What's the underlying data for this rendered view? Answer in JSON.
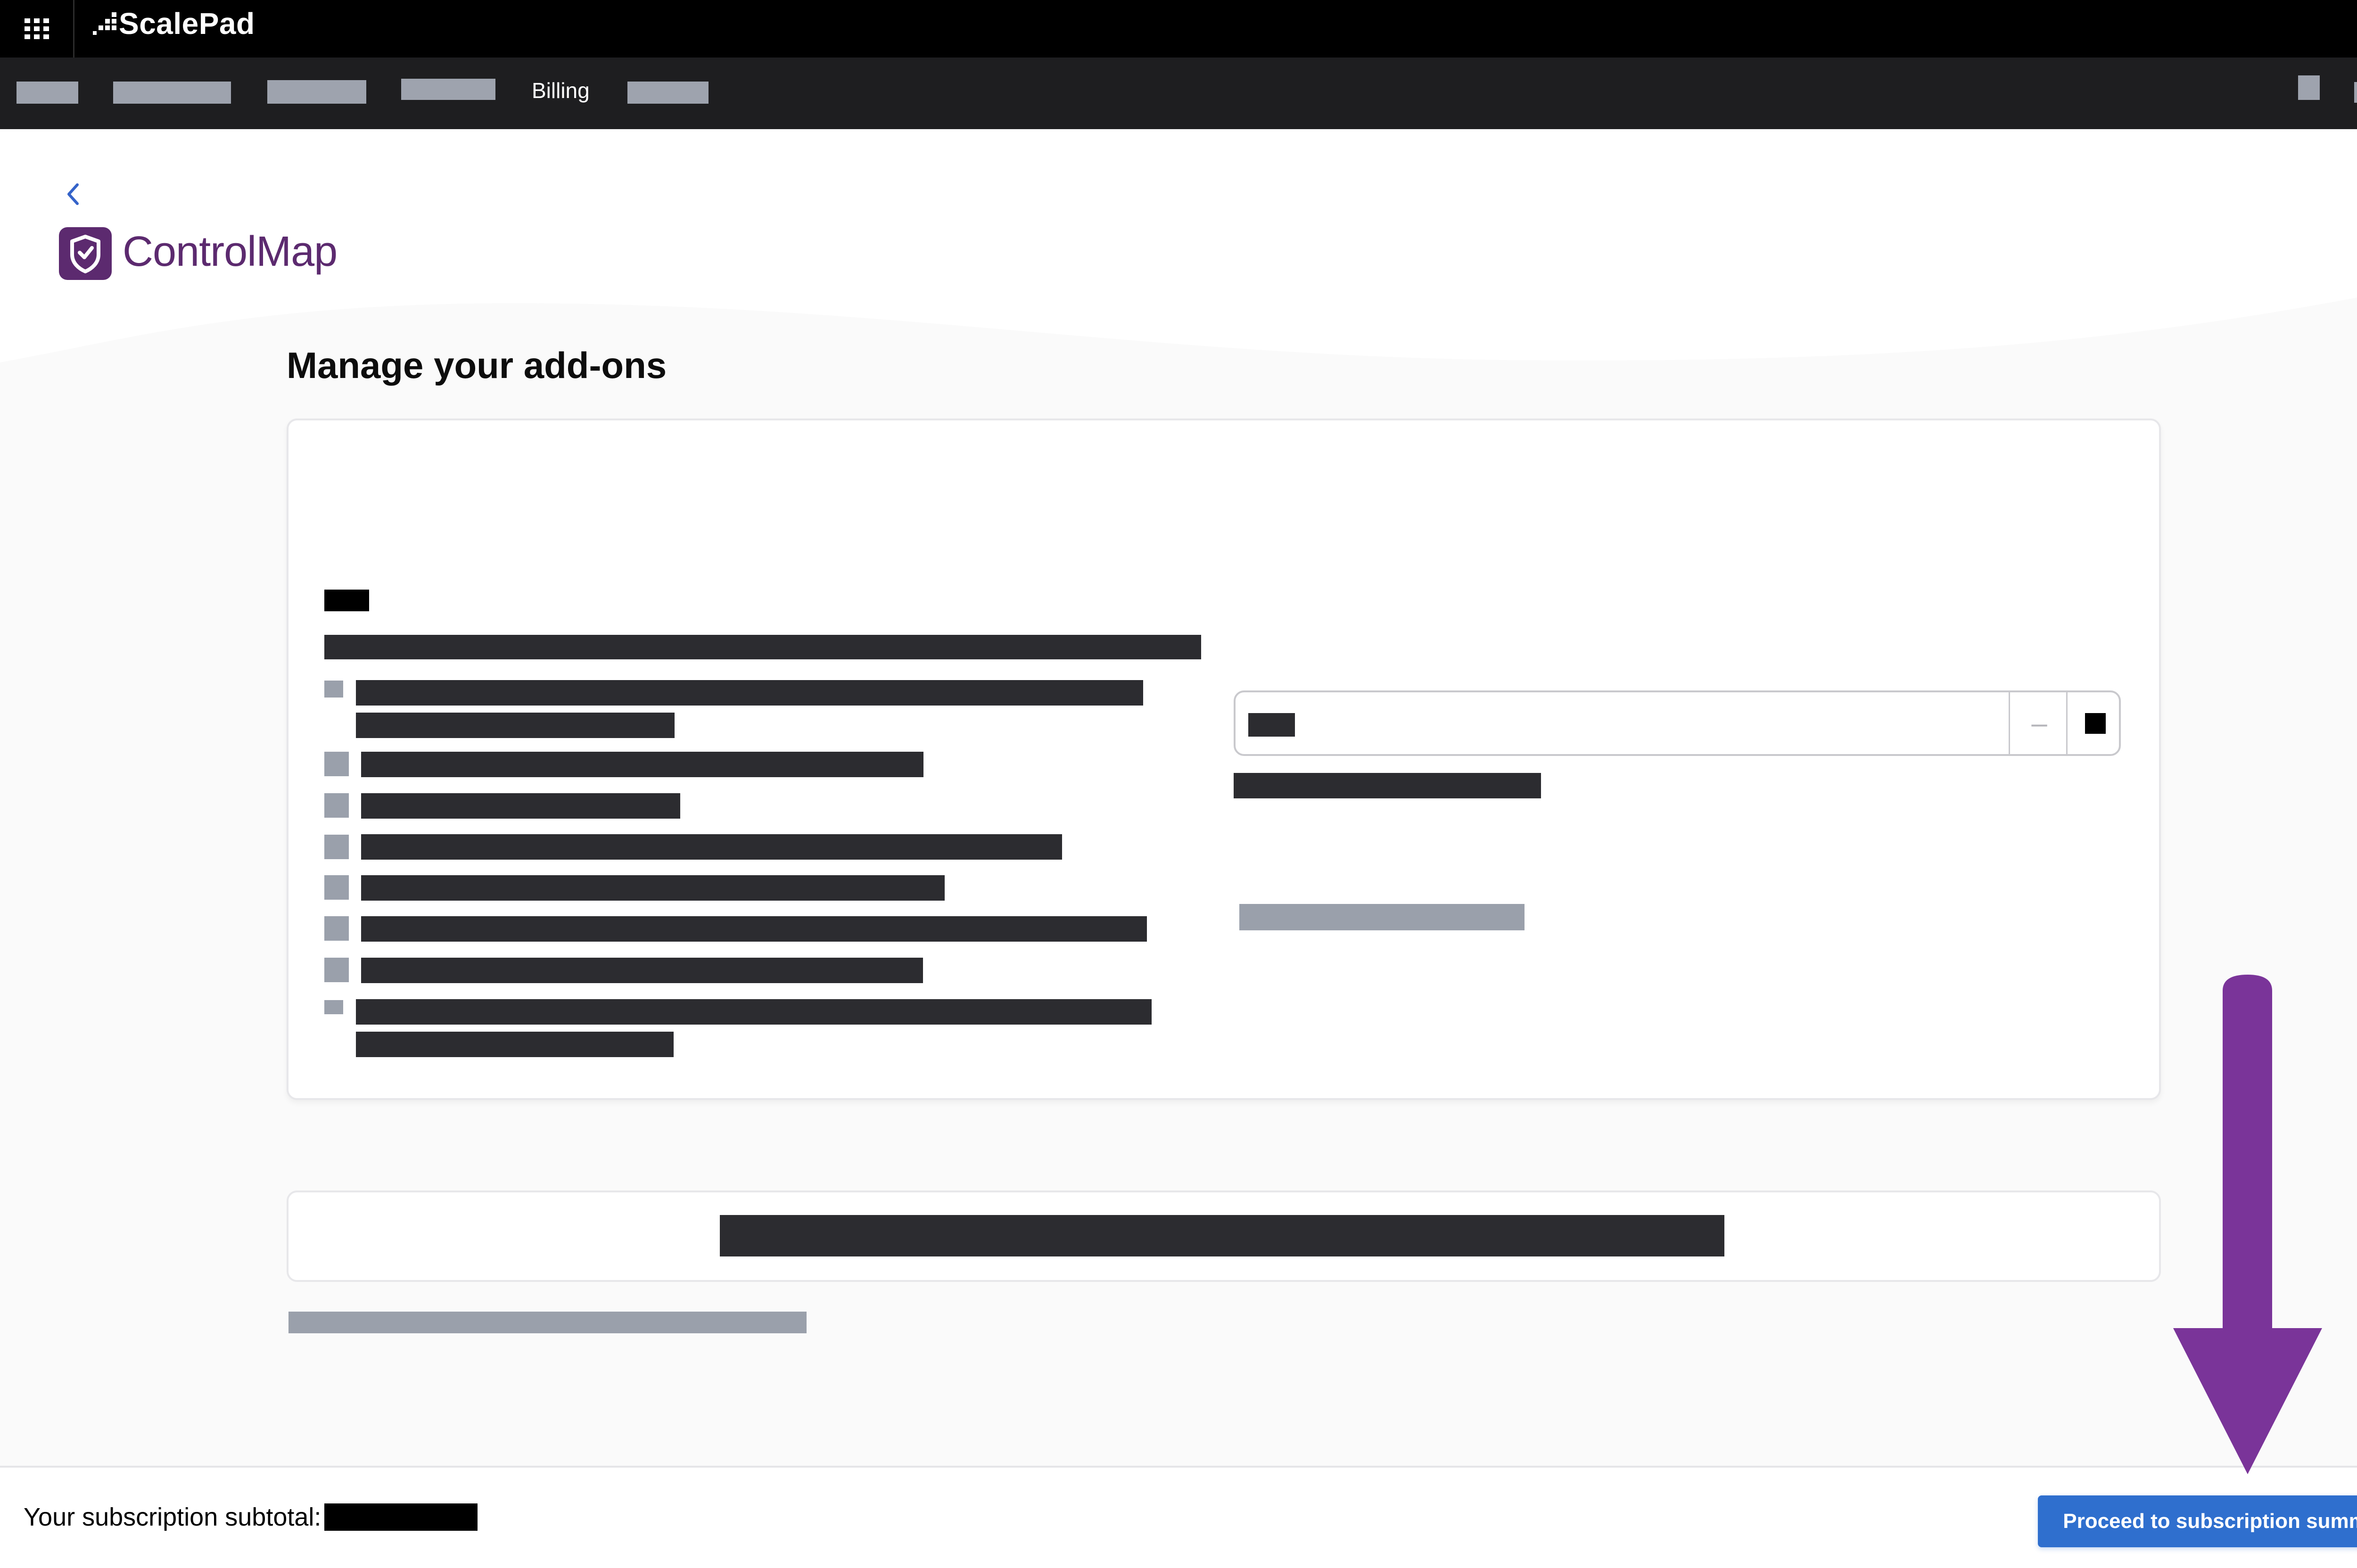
{
  "top_bar": {
    "brand": "ScalePad",
    "icons": [
      "app-grid-icon",
      "scalepad-logo-icon"
    ]
  },
  "nav": {
    "active_item_label": "Billing"
  },
  "product": {
    "name": "ControlMap",
    "back_icon": "chevron-left-icon"
  },
  "main": {
    "title": "Manage your add-ons"
  },
  "stepper": {
    "decrement_label": "–",
    "icons": [
      "minus-icon",
      "plus-icon"
    ]
  },
  "footer": {
    "subtotal_label": "Your subscription subtotal:",
    "proceed_label": "Proceed to subscription summary"
  },
  "colors": {
    "accent": "#2f6fce",
    "brand_purple": "#5c2a6f",
    "arrow": "#7a3499",
    "header_bg": "#000000",
    "nav_bg": "#1e1e20"
  }
}
